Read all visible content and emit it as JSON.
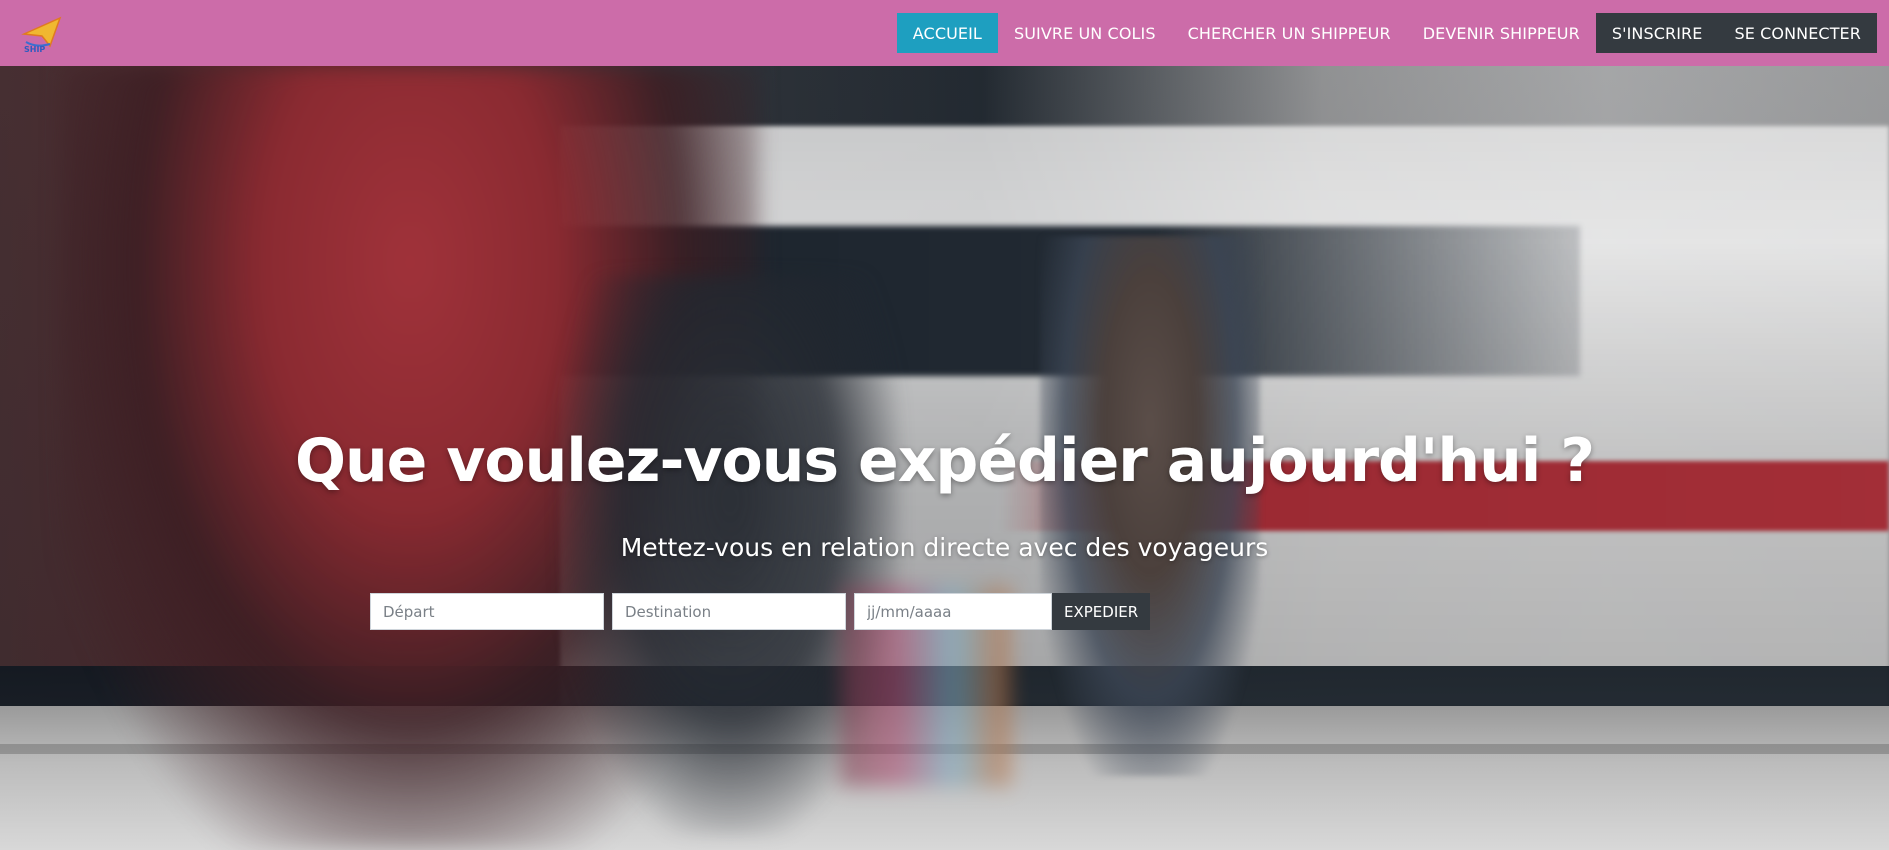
{
  "brand": {
    "logo_icon": "paper-plane-logo-icon",
    "accent_color": "#cc6ca9"
  },
  "nav": {
    "items": [
      {
        "label": "ACCUEIL",
        "state": "active",
        "color": "#1e9fc0"
      },
      {
        "label": "SUIVRE UN COLIS"
      },
      {
        "label": "CHERCHER UN SHIPPEUR"
      },
      {
        "label": "DEVENIR SHIPPEUR"
      },
      {
        "label": "S'INSCRIRE",
        "color": "#343a40"
      },
      {
        "label": "SE CONNECTER",
        "color": "#343a40"
      }
    ]
  },
  "hero": {
    "title": "Que voulez-vous expédier aujourd'hui ?",
    "subtitle": "Mettez-vous en relation directe avec des voyageurs"
  },
  "search": {
    "depart_placeholder": "Départ",
    "destination_placeholder": "Destination",
    "date_placeholder": "jj/mm/aaaa",
    "submit_label": "EXPEDIER"
  }
}
